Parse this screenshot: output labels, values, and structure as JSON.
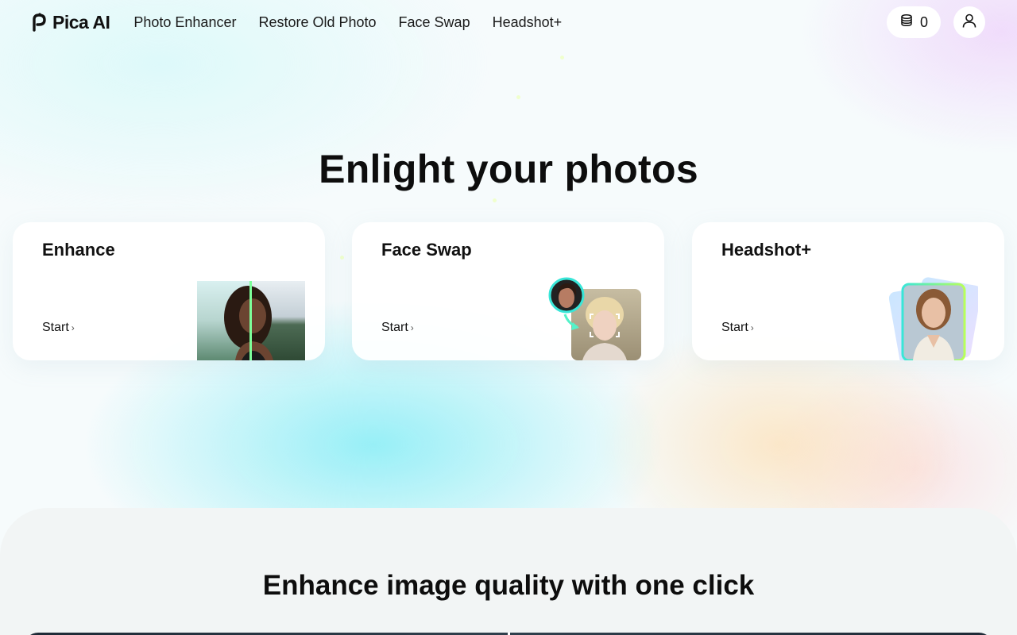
{
  "header": {
    "logo_text": "Pica AI",
    "nav": [
      {
        "label": "Photo Enhancer"
      },
      {
        "label": "Restore Old Photo"
      },
      {
        "label": "Face Swap"
      },
      {
        "label": "Headshot+"
      }
    ],
    "credits_count": "0",
    "icons": {
      "credits": "coins-stack-icon",
      "account": "user-icon"
    }
  },
  "hero": {
    "title": "Enlight your photos",
    "cards": [
      {
        "title": "Enhance",
        "action": "Start",
        "image": "enhance-before-after-portrait"
      },
      {
        "title": "Face Swap",
        "action": "Start",
        "image": "face-swap-portrait"
      },
      {
        "title": "Headshot+",
        "action": "Start",
        "image": "headshot-portrait-stack"
      }
    ]
  },
  "section": {
    "title": "Enhance image quality with one click"
  },
  "colors": {
    "accent_cyan": "#6ef0e8",
    "accent_green": "#7dff7a",
    "text": "#111111",
    "card_bg": "#ffffff"
  }
}
